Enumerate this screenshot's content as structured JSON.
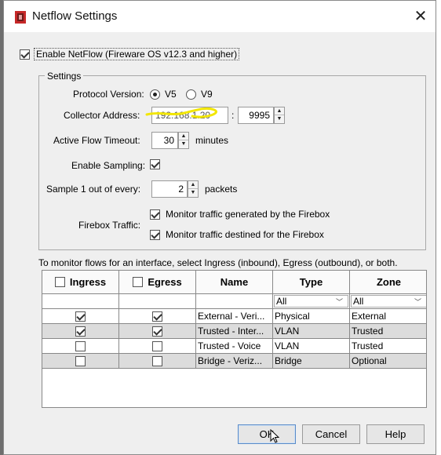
{
  "dialog": {
    "title": "Netflow Settings",
    "close_glyph": "✕"
  },
  "enable_netflow": {
    "label": "Enable NetFlow (Fireware OS v12.3 and higher)",
    "checked": true
  },
  "settings": {
    "legend": "Settings",
    "protocol_version": {
      "label": "Protocol Version:",
      "options": [
        {
          "label": "V5",
          "selected": true
        },
        {
          "label": "V9",
          "selected": false
        }
      ]
    },
    "collector": {
      "label": "Collector Address:",
      "address": "192.168.1.20",
      "separator": ":",
      "port": "9995"
    },
    "active_flow_timeout": {
      "label": "Active Flow Timeout:",
      "value": "30",
      "unit": "minutes"
    },
    "enable_sampling": {
      "label": "Enable Sampling:",
      "checked": true
    },
    "sample": {
      "label": "Sample 1 out of every:",
      "value": "2",
      "unit": "packets"
    },
    "firebox_traffic": {
      "label": "Firebox Traffic:",
      "options": [
        {
          "label": "Monitor traffic generated by the Firebox",
          "checked": true
        },
        {
          "label": "Monitor traffic destined for the Firebox",
          "checked": true
        }
      ]
    }
  },
  "instructions": "To monitor flows for an interface, select Ingress (inbound), Egress (outbound), or both.",
  "table": {
    "headers": {
      "ingress": "Ingress",
      "egress": "Egress",
      "name": "Name",
      "type": "Type",
      "zone": "Zone"
    },
    "filters": {
      "type": "All",
      "zone": "All"
    },
    "rows": [
      {
        "ingress": true,
        "egress": true,
        "name": "External - Veri...",
        "type": "Physical",
        "zone": "External"
      },
      {
        "ingress": true,
        "egress": true,
        "name": "Trusted - Inter...",
        "type": "VLAN",
        "zone": "Trusted"
      },
      {
        "ingress": false,
        "egress": false,
        "name": "Trusted - Voice",
        "type": "VLAN",
        "zone": "Trusted"
      },
      {
        "ingress": false,
        "egress": false,
        "name": "Bridge - Veriz...",
        "type": "Bridge",
        "zone": "Optional"
      }
    ]
  },
  "buttons": {
    "ok": "OK",
    "cancel": "Cancel",
    "help": "Help"
  },
  "colors": {
    "annotation_scribble": "#f2e600",
    "default_button_border": "#5b8cc8"
  },
  "icons": {
    "app": "netflow-app-icon",
    "close": "close-icon",
    "dropdown": "chevron-down-icon"
  }
}
